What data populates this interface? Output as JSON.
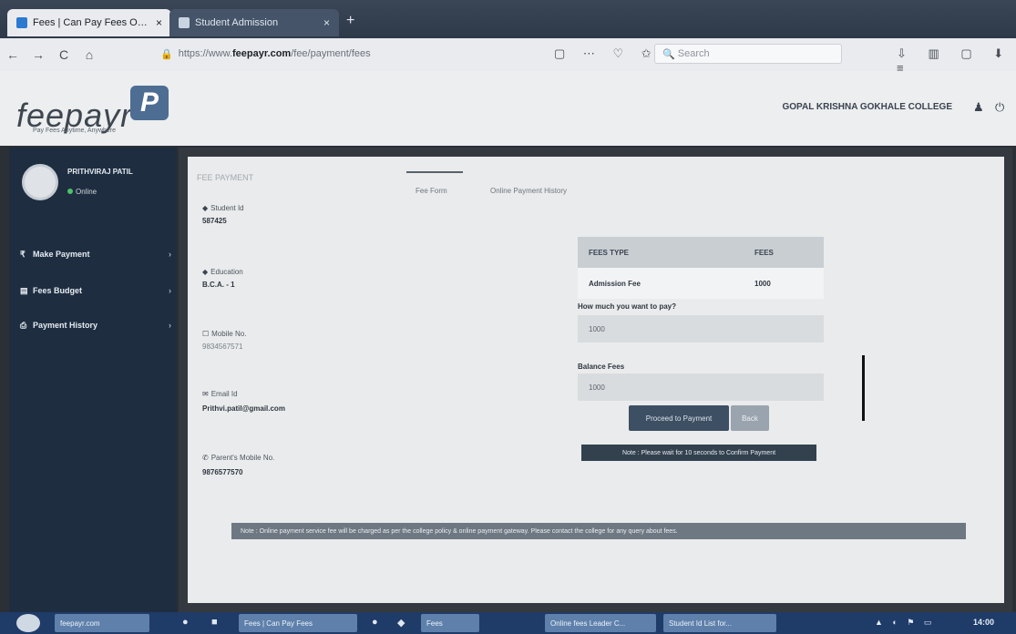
{
  "browser": {
    "tabs": [
      {
        "label": "Fees | Can Pay Fees Online",
        "close": "×"
      },
      {
        "label": "Student Admission",
        "close": "×"
      }
    ],
    "new_tab": "+",
    "nav": {
      "back": "←",
      "forward": "→",
      "reload": "C",
      "home": "⌂"
    },
    "url_prefix": "https://www.",
    "url_domain": "feepayr.com",
    "url_path": "/fee/payment/fees",
    "search_placeholder": "Search",
    "page_actions": "▢ ⋯ ♡ ✩",
    "tool_icons": "⇩ ▥ ▢ ⬇ ≡"
  },
  "header": {
    "logo_text": "feepayr",
    "logo_badge": "P",
    "logo_tagline": "Pay Fees Anytime, Anywhere",
    "college_name": "GOPAL KRISHNA GOKHALE COLLEGE",
    "bell_icon": "♟",
    "power_icon": "⏻"
  },
  "sidebar": {
    "user_name": "PRITHVIRAJ PATIL",
    "user_status": "Online",
    "items": [
      {
        "icon": "₹",
        "label": "Make Payment",
        "chev": "›"
      },
      {
        "icon": "▤",
        "label": "Fees Budget",
        "chev": "›"
      },
      {
        "icon": "⎙",
        "label": "Payment History",
        "chev": "›"
      }
    ]
  },
  "main": {
    "breadcrumb": "FEE PAYMENT",
    "tabs": [
      "Fee Form",
      "Online Payment History"
    ],
    "student": {
      "student_id_label": "Student Id",
      "student_id": "587425",
      "education_label": "Education",
      "education": "B.C.A. - 1",
      "mobile_label": "Mobile No.",
      "mobile": "9834567571",
      "email_label": "Email Id",
      "email": "Prithvi.patil@gmail.com",
      "parent_mobile_label": "Parent's Mobile No.",
      "parent_mobile": "9876577570"
    },
    "fee_table": {
      "headers": [
        "FEES TYPE",
        "FEES"
      ],
      "rows": [
        {
          "type": "Admission Fee",
          "amount": "1000"
        }
      ]
    },
    "pay_question": "How much you want to pay?",
    "pay_value": "1000",
    "balance_label": "Balance Fees",
    "balance_value": "1000",
    "proceed_button": "Proceed to Payment",
    "back_button": "Back",
    "note": "Note : Please wait for 10 seconds to Confirm Payment",
    "footer_notice": "Note : Online payment service fee will be charged as per the college policy & online payment gateway. Please contact the college for any query about fees."
  },
  "taskbar": {
    "items": [
      "feepayr.com",
      "Fees | Can Pay Fees",
      "Fees",
      "Online fees Leader C...",
      "Student Id List for..."
    ],
    "tray": "▲ ◐ ⚑ ▭",
    "clock": "14:00"
  }
}
